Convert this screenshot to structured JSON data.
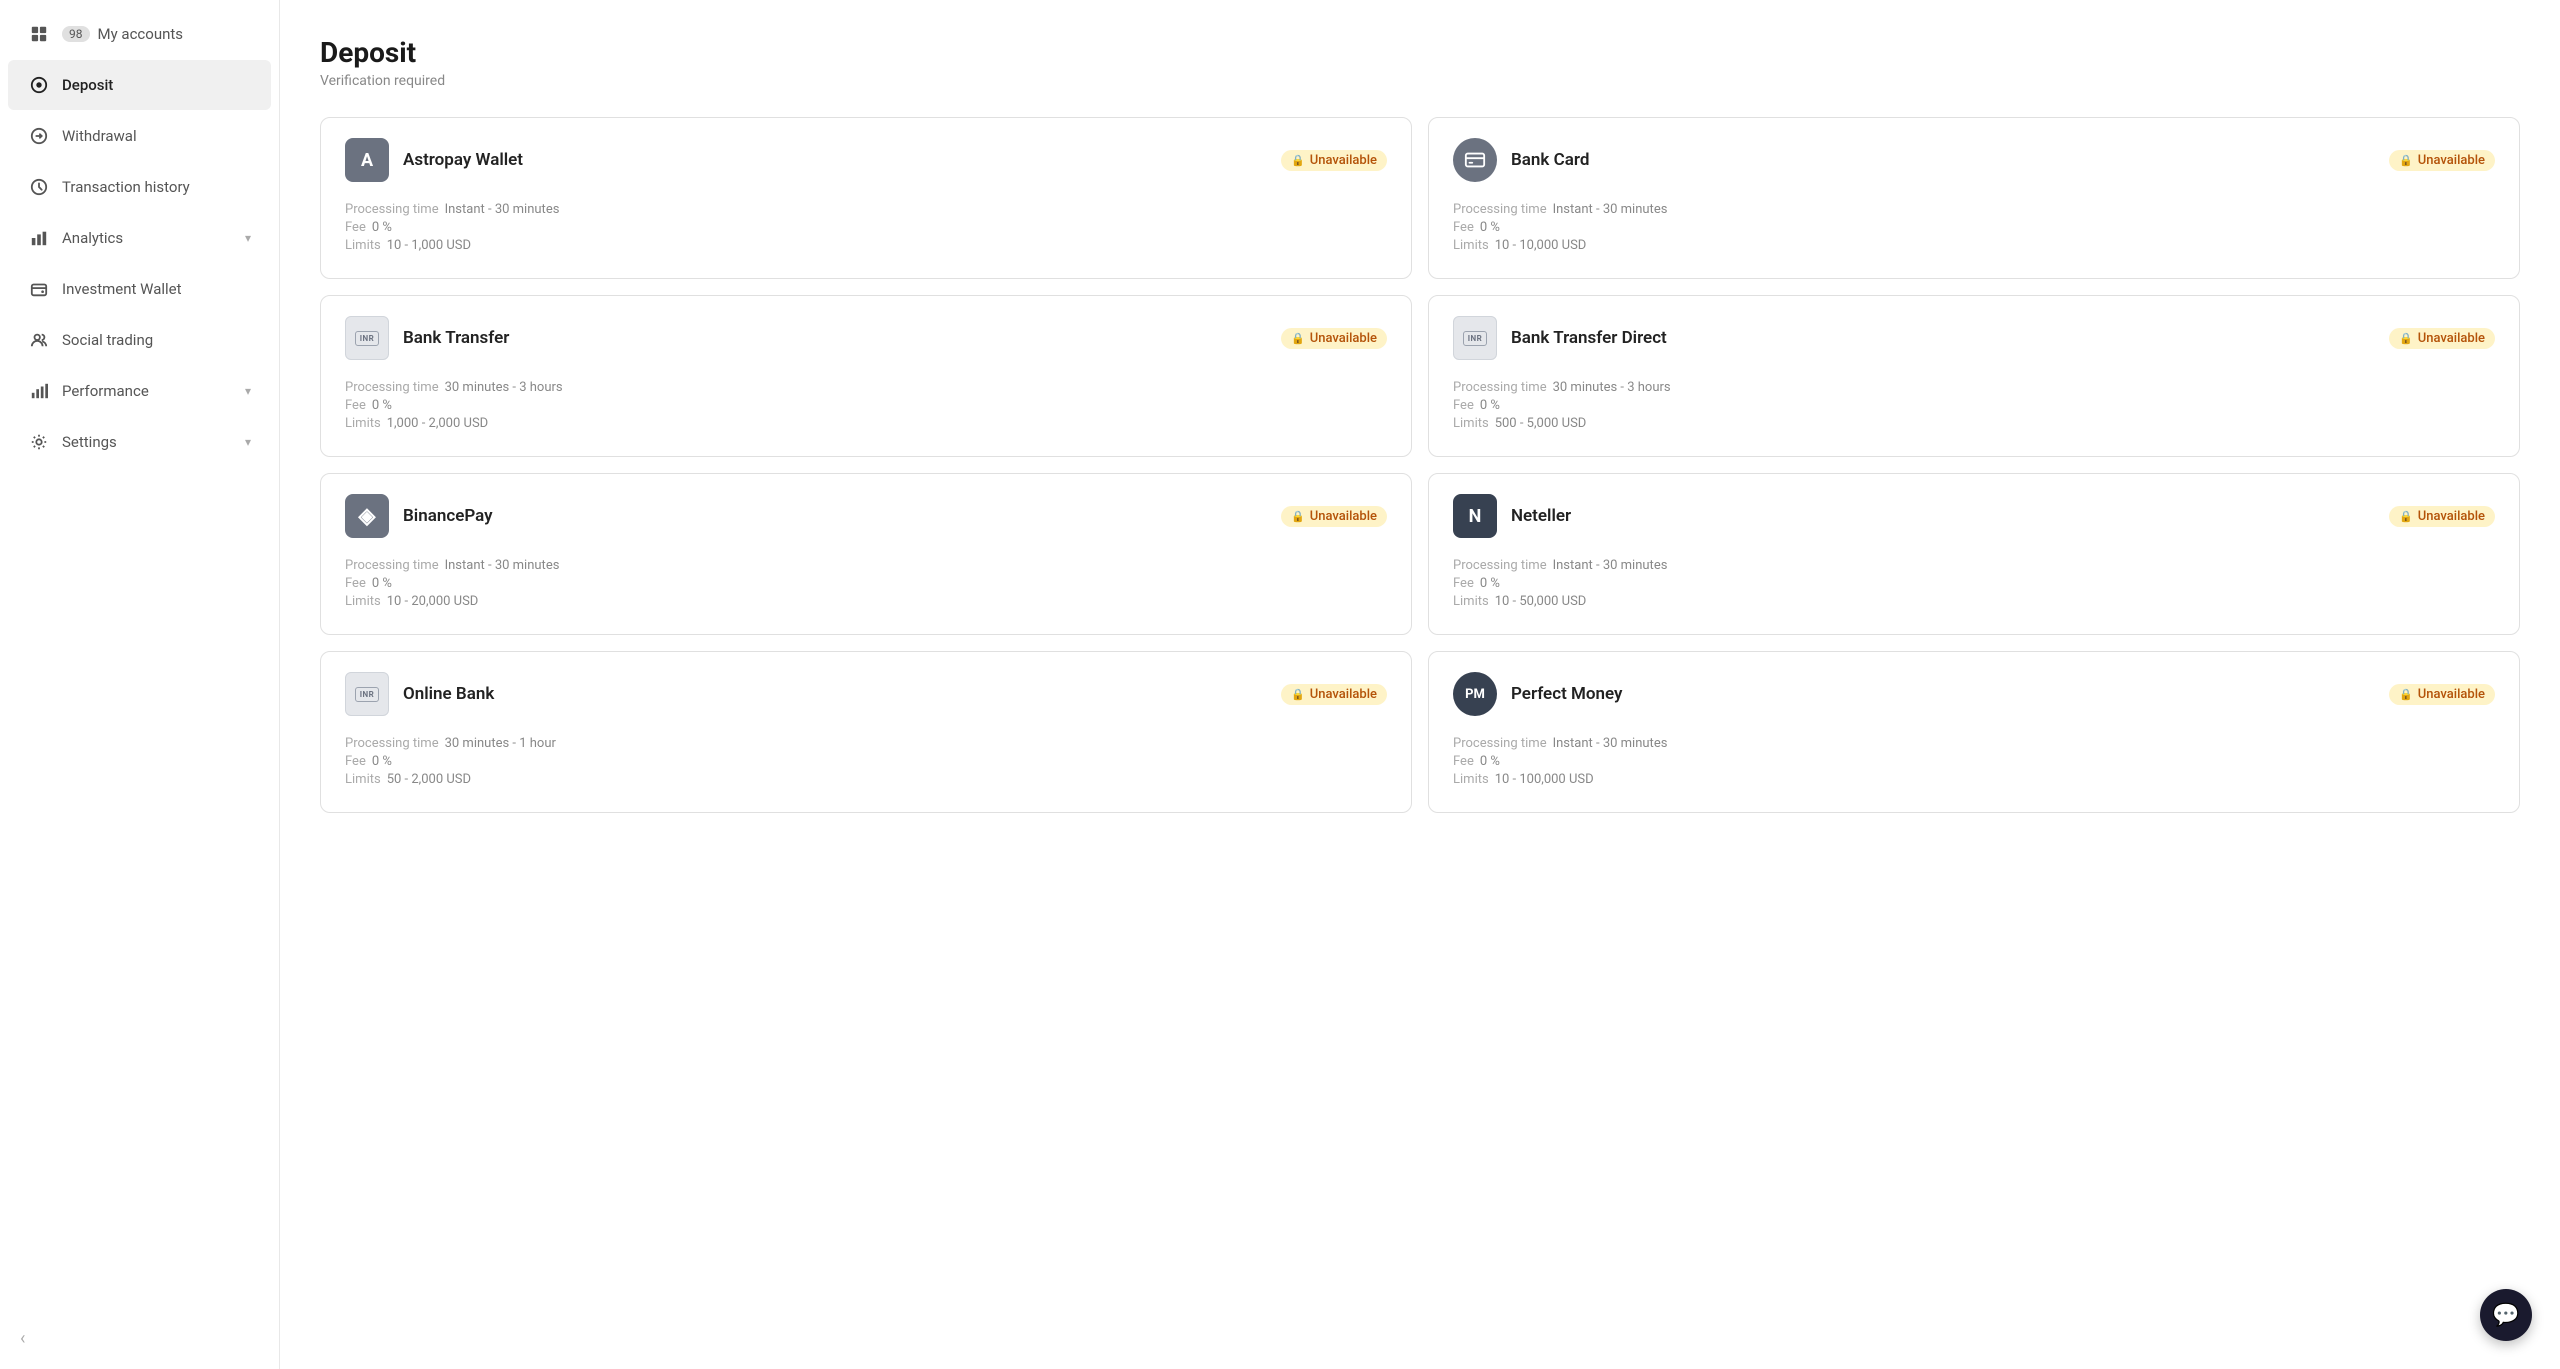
{
  "sidebar": {
    "collapse_label": "‹",
    "items": [
      {
        "id": "my-accounts",
        "label": "My accounts",
        "badge": "98",
        "icon": "grid-icon",
        "active": false,
        "has_chevron": false
      },
      {
        "id": "deposit",
        "label": "Deposit",
        "icon": "circle-dot-icon",
        "active": true,
        "has_chevron": false
      },
      {
        "id": "withdrawal",
        "label": "Withdrawal",
        "icon": "circle-arrow-icon",
        "active": false,
        "has_chevron": false
      },
      {
        "id": "transaction-history",
        "label": "Transaction history",
        "icon": "clock-icon",
        "active": false,
        "has_chevron": false
      },
      {
        "id": "analytics",
        "label": "Analytics",
        "icon": "chart-bar-icon",
        "active": false,
        "has_chevron": true
      },
      {
        "id": "investment-wallet",
        "label": "Investment Wallet",
        "icon": "wallet-icon",
        "active": false,
        "has_chevron": false
      },
      {
        "id": "social-trading",
        "label": "Social trading",
        "icon": "users-icon",
        "active": false,
        "has_chevron": false
      },
      {
        "id": "performance",
        "label": "Performance",
        "icon": "bar-chart-icon",
        "active": false,
        "has_chevron": true
      },
      {
        "id": "settings",
        "label": "Settings",
        "icon": "gear-icon",
        "active": false,
        "has_chevron": true
      }
    ]
  },
  "page": {
    "title": "Deposit",
    "verification_notice": "Verification required"
  },
  "payment_methods": [
    {
      "id": "astropay",
      "name": "Astropay Wallet",
      "logo_type": "letter",
      "logo_text": "A",
      "logo_style": "gray-bg",
      "status": "Unavailable",
      "processing_time": "Instant - 30 minutes",
      "fee": "0 %",
      "limits": "10 - 1,000 USD"
    },
    {
      "id": "bank-card",
      "name": "Bank Card",
      "logo_type": "svg-card",
      "logo_text": "",
      "logo_style": "circle-gray",
      "status": "Unavailable",
      "processing_time": "Instant - 30 minutes",
      "fee": "0 %",
      "limits": "10 - 10,000 USD"
    },
    {
      "id": "bank-transfer",
      "name": "Bank Transfer",
      "logo_type": "inr",
      "logo_text": "INR",
      "logo_style": "inr",
      "status": "Unavailable",
      "processing_time": "30 minutes - 3 hours",
      "fee": "0 %",
      "limits": "1,000 - 2,000 USD"
    },
    {
      "id": "bank-transfer-direct",
      "name": "Bank Transfer Direct",
      "logo_type": "inr",
      "logo_text": "INR",
      "logo_style": "inr",
      "status": "Unavailable",
      "processing_time": "30 minutes - 3 hours",
      "fee": "0 %",
      "limits": "500 - 5,000 USD"
    },
    {
      "id": "binancepay",
      "name": "BinancePay",
      "logo_type": "binance",
      "logo_text": "◈",
      "logo_style": "gray-bg",
      "status": "Unavailable",
      "processing_time": "Instant - 30 minutes",
      "fee": "0 %",
      "limits": "10 - 20,000 USD"
    },
    {
      "id": "neteller",
      "name": "Neteller",
      "logo_type": "letter",
      "logo_text": "N",
      "logo_style": "dark-bg",
      "status": "Unavailable",
      "processing_time": "Instant - 30 minutes",
      "fee": "0 %",
      "limits": "10 - 50,000 USD"
    },
    {
      "id": "online-bank",
      "name": "Online Bank",
      "logo_type": "inr",
      "logo_text": "INR",
      "logo_style": "inr",
      "status": "Unavailable",
      "processing_time": "30 minutes - 1 hour",
      "fee": "0 %",
      "limits": "50 - 2,000 USD"
    },
    {
      "id": "perfect-money",
      "name": "Perfect Money",
      "logo_type": "pm",
      "logo_text": "PM",
      "logo_style": "circle-dark",
      "status": "Unavailable",
      "processing_time": "Instant - 30 minutes",
      "fee": "0 %",
      "limits": "10 - 100,000 USD"
    }
  ],
  "labels": {
    "processing_time": "Processing time",
    "fee": "Fee",
    "limits": "Limits",
    "unavailable": "Unavailable",
    "chat_icon": "💬"
  }
}
